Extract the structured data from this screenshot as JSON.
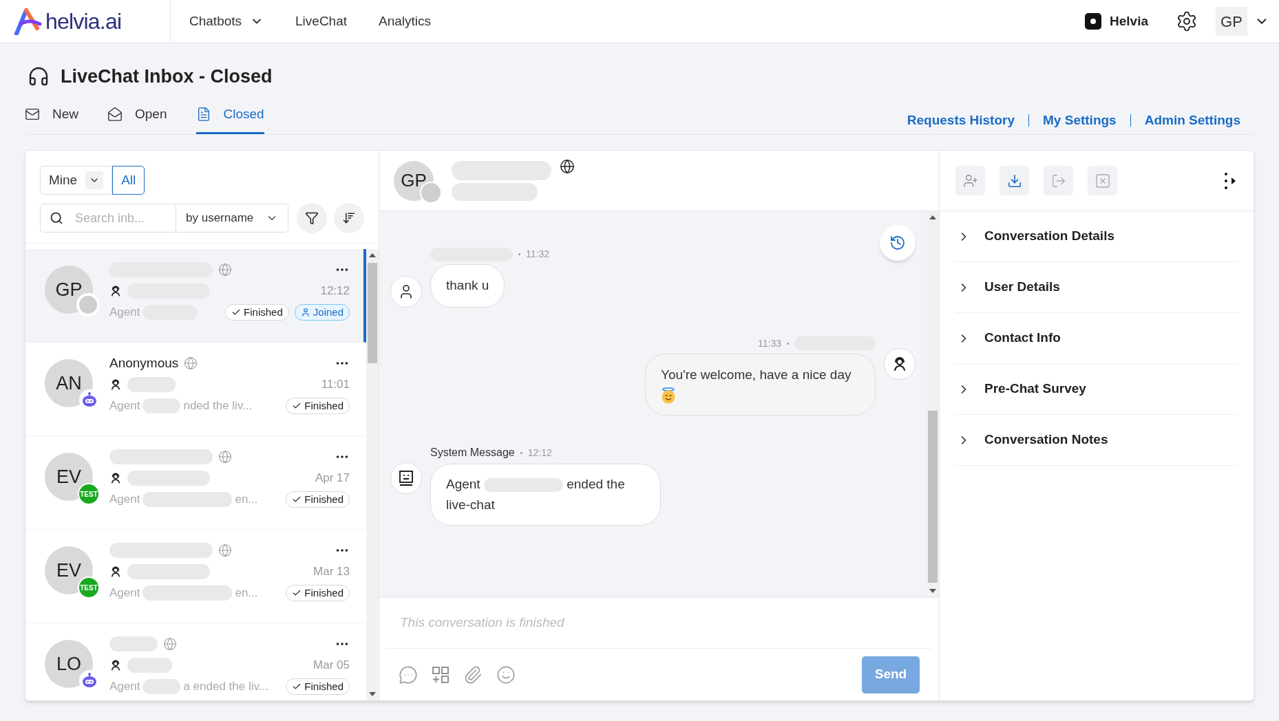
{
  "nav": {
    "logo": "helvia.ai",
    "items": [
      {
        "label": "Chatbots",
        "dropdown": true
      },
      {
        "label": "LiveChat",
        "dropdown": false
      },
      {
        "label": "Analytics",
        "dropdown": false
      }
    ],
    "workspace": "Helvia",
    "user_initials": "GP"
  },
  "page": {
    "title": "LiveChat Inbox - Closed"
  },
  "tabs": [
    {
      "label": "New",
      "kind": "new",
      "selected": false
    },
    {
      "label": "Open",
      "kind": "open",
      "selected": false
    },
    {
      "label": "Closed",
      "kind": "closed",
      "selected": true
    }
  ],
  "links": [
    "Requests History",
    "My Settings",
    "Admin Settings"
  ],
  "inbox": {
    "scope": [
      {
        "label": "Mine",
        "dropdown": true,
        "selected": false
      },
      {
        "label": "All",
        "dropdown": false,
        "selected": true
      }
    ],
    "search": {
      "placeholder": "Search inb..."
    },
    "search_by": "by username",
    "conversations": [
      {
        "initials": "GP",
        "kind": "plain",
        "time": "12:12",
        "preview_start": "Agent",
        "statuses": [
          {
            "label": "Finished",
            "kind": "finished"
          },
          {
            "label": "Joined",
            "kind": "joined"
          }
        ],
        "selected": true
      },
      {
        "initials": "AN",
        "kind": "bot",
        "name": "Anonymous",
        "time": "11:01",
        "preview_start": "Agent",
        "preview_end": "nded the liv...",
        "statuses": [
          {
            "label": "Finished",
            "kind": "finished"
          }
        ],
        "selected": false
      },
      {
        "initials": "EV",
        "kind": "test",
        "badge_text": "TEST",
        "time": "Apr 17",
        "preview_start": "Agent",
        "preview_end": "en...",
        "statuses": [
          {
            "label": "Finished",
            "kind": "finished"
          }
        ],
        "selected": false
      },
      {
        "initials": "EV",
        "kind": "test",
        "badge_text": "TEST",
        "time": "Mar 13",
        "preview_start": "Agent",
        "preview_end": "en...",
        "statuses": [
          {
            "label": "Finished",
            "kind": "finished"
          }
        ],
        "selected": false
      },
      {
        "initials": "LO",
        "kind": "bot",
        "time": "Mar 05",
        "preview_start": "Agent",
        "preview_end": "a ended the liv...",
        "statuses": [
          {
            "label": "Finished",
            "kind": "finished"
          }
        ],
        "selected": false
      }
    ]
  },
  "chat": {
    "initials": "GP",
    "messages": [
      {
        "kind": "user",
        "time": "11:32",
        "text": "thank u"
      },
      {
        "kind": "agent",
        "time": "11:33",
        "text": "You're welcome, have a nice day"
      },
      {
        "kind": "system",
        "sender": "System Message",
        "time": "12:12",
        "text_start": "Agent",
        "text_end": "ended the live-chat"
      }
    ],
    "composer": {
      "placeholder": "This conversation is finished"
    },
    "send": "Send"
  },
  "details": {
    "sections": [
      {
        "label": "Conversation Details",
        "expanded": false
      },
      {
        "label": "User Details",
        "expanded": false
      },
      {
        "label": "Contact Info",
        "expanded": false
      },
      {
        "label": "Pre-Chat Survey",
        "expanded": false
      },
      {
        "label": "Conversation Notes",
        "expanded": false
      }
    ]
  }
}
